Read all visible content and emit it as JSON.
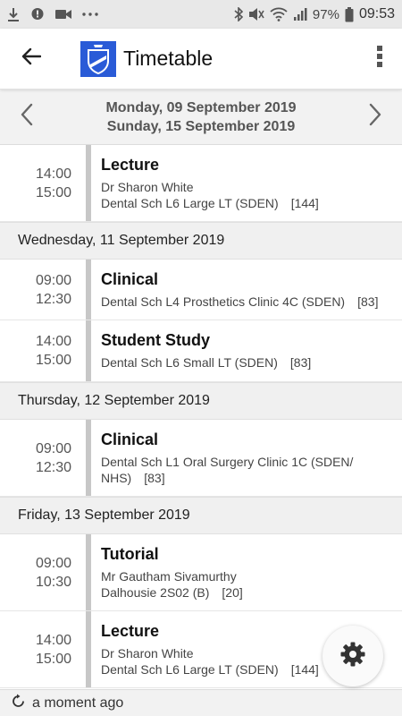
{
  "status_bar": {
    "battery": "97%",
    "time": "09:53",
    "left_icons": [
      "download-icon",
      "chat-icon",
      "video-icon",
      "more-dots-icon"
    ],
    "right_icons": [
      "bluetooth-icon",
      "mute-icon",
      "wifi-icon",
      "signal-icon"
    ]
  },
  "app_bar": {
    "title": "Timetable",
    "back_icon": "back-arrow-icon",
    "menu_icon": "overflow-menu-icon",
    "logo_color": "#2a5bd7"
  },
  "range": {
    "start": "Monday, 09 September 2019",
    "end": "Sunday, 15 September 2019"
  },
  "days": [
    {
      "header": "",
      "events": [
        {
          "start": "14:00",
          "end": "15:00",
          "title": "Lecture",
          "lines": [
            {
              "text": "Dr Sharon White",
              "cap": ""
            },
            {
              "text": "Dental Sch L6 Large LT (SDEN)",
              "cap": "[144]"
            }
          ]
        }
      ]
    },
    {
      "header": "Wednesday, 11 September 2019",
      "events": [
        {
          "start": "09:00",
          "end": "12:30",
          "title": "Clinical",
          "lines": [
            {
              "text": "Dental Sch L4 Prosthetics Clinic 4C (SDEN)",
              "cap": "[83]"
            }
          ]
        },
        {
          "start": "14:00",
          "end": "15:00",
          "title": "Student Study",
          "lines": [
            {
              "text": "Dental Sch L6 Small LT (SDEN)",
              "cap": "[83]"
            }
          ]
        }
      ]
    },
    {
      "header": "Thursday, 12 September 2019",
      "events": [
        {
          "start": "09:00",
          "end": "12:30",
          "title": "Clinical",
          "lines": [
            {
              "text": "Dental Sch L1 Oral Surgery Clinic 1C (SDEN/",
              "cap": ""
            },
            {
              "text": "NHS)",
              "cap": "[83]"
            }
          ]
        }
      ]
    },
    {
      "header": "Friday, 13 September 2019",
      "events": [
        {
          "start": "09:00",
          "end": "10:30",
          "title": "Tutorial",
          "lines": [
            {
              "text": "Mr Gautham Sivamurthy",
              "cap": ""
            },
            {
              "text": "Dalhousie 2S02 (B)",
              "cap": "[20]"
            }
          ]
        },
        {
          "start": "14:00",
          "end": "15:00",
          "title": "Lecture",
          "lines": [
            {
              "text": "Dr Sharon White",
              "cap": ""
            },
            {
              "text": "Dental Sch L6 Large LT (SDEN)",
              "cap": "[144]"
            }
          ]
        }
      ]
    }
  ],
  "fab": {
    "icon": "settings-gear-icon"
  },
  "footer": {
    "refresh_icon": "refresh-icon",
    "text": "a moment ago"
  },
  "colors": {
    "event_bar": "#c7c7c7",
    "day_header_bg": "#f0f0f0"
  }
}
